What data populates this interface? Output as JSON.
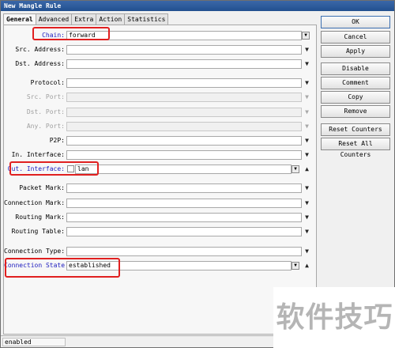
{
  "window": {
    "title": "New Mangle Rule"
  },
  "tabs": [
    {
      "label": "General",
      "active": true
    },
    {
      "label": "Advanced"
    },
    {
      "label": "Extra"
    },
    {
      "label": "Action"
    },
    {
      "label": "Statistics"
    }
  ],
  "form": {
    "chain": {
      "label": "Chain:",
      "value": "forward"
    },
    "src_address": {
      "label": "Src. Address:",
      "value": ""
    },
    "dst_address": {
      "label": "Dst. Address:",
      "value": ""
    },
    "protocol": {
      "label": "Protocol:",
      "value": ""
    },
    "src_port": {
      "label": "Src. Port:",
      "value": ""
    },
    "dst_port": {
      "label": "Dst. Port:",
      "value": ""
    },
    "any_port": {
      "label": "Any. Port:",
      "value": ""
    },
    "p2p": {
      "label": "P2P:",
      "value": ""
    },
    "in_interface": {
      "label": "In. Interface:",
      "value": ""
    },
    "out_interface": {
      "label": "Out. Interface:",
      "value": "lan"
    },
    "packet_mark": {
      "label": "Packet Mark:",
      "value": ""
    },
    "connection_mark": {
      "label": "Connection Mark:",
      "value": ""
    },
    "routing_mark": {
      "label": "Routing Mark:",
      "value": ""
    },
    "routing_table": {
      "label": "Routing Table:",
      "value": ""
    },
    "connection_type": {
      "label": "Connection Type:",
      "value": ""
    },
    "connection_state": {
      "label": "Connection State:",
      "value": "established"
    }
  },
  "buttons": {
    "ok": "OK",
    "cancel": "Cancel",
    "apply": "Apply",
    "disable": "Disable",
    "comment": "Comment",
    "copy": "Copy",
    "remove": "Remove",
    "reset_counters": "Reset Counters",
    "reset_all_counters": "Reset All Counters"
  },
  "status": {
    "text": "enabled"
  },
  "watermark": {
    "text": "软件技巧"
  },
  "colors": {
    "title_bar": "#2d5c9c",
    "highlight": "#e02020",
    "label_blue": "#2020c0"
  }
}
